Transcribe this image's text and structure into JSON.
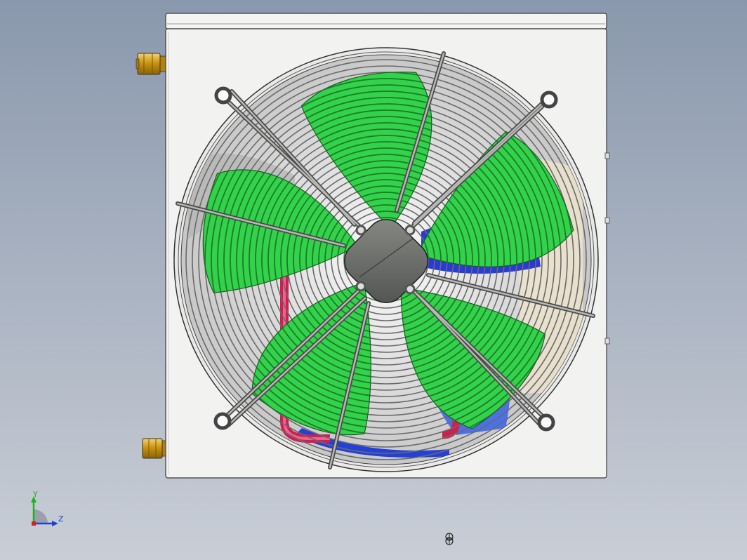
{
  "viewport": {
    "background_top": "#8a98ad",
    "background_bottom": "#c9ced6"
  },
  "model": {
    "housing_color": "#f0f0ee",
    "blade_color": "#33d24b",
    "blade_stripe_color": "#1e7a2a",
    "guard_color": "#8a8a88",
    "hub_color": "#6d6f6c",
    "fitting_color": "#d6a51a",
    "coil_red": "#cc2050",
    "coil_blue": "#2340d8",
    "blade_count": 5
  },
  "triad": {
    "y_label": "Y",
    "z_label": "Z",
    "y_color": "#20b020",
    "z_color": "#2040d0"
  },
  "icons": {
    "rotate_center": "rotation-center-icon"
  }
}
